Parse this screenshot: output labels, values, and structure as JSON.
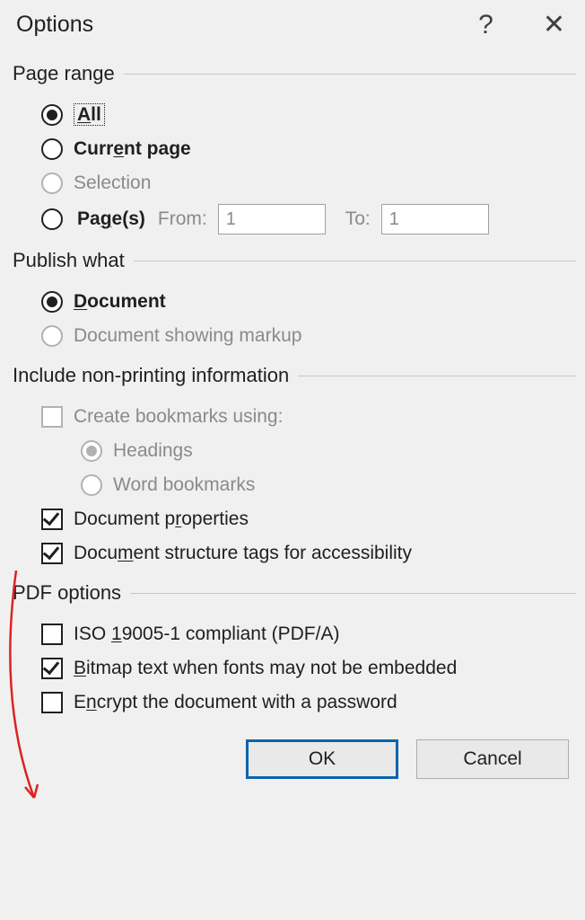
{
  "title": "Options",
  "page_range": {
    "heading": "Page range",
    "all": "All",
    "current": "Current page",
    "selection": "Selection",
    "pages": "Page(s)",
    "from_label": "From:",
    "to_label": "To:",
    "from_value": "1",
    "to_value": "1"
  },
  "publish": {
    "heading": "Publish what",
    "document": "Document",
    "markup": "Document showing markup"
  },
  "include": {
    "heading": "Include non-printing information",
    "create_bookmarks": "Create bookmarks using:",
    "headings": "Headings",
    "word_bookmarks": "Word bookmarks",
    "doc_properties": "Document properties",
    "structure_tags": "Document structure tags for accessibility"
  },
  "pdf": {
    "heading": "PDF options",
    "iso": "ISO 19005-1 compliant (PDF/A)",
    "bitmap": "Bitmap text when fonts may not be embedded",
    "encrypt": "Encrypt the document with a password"
  },
  "buttons": {
    "ok": "OK",
    "cancel": "Cancel"
  }
}
